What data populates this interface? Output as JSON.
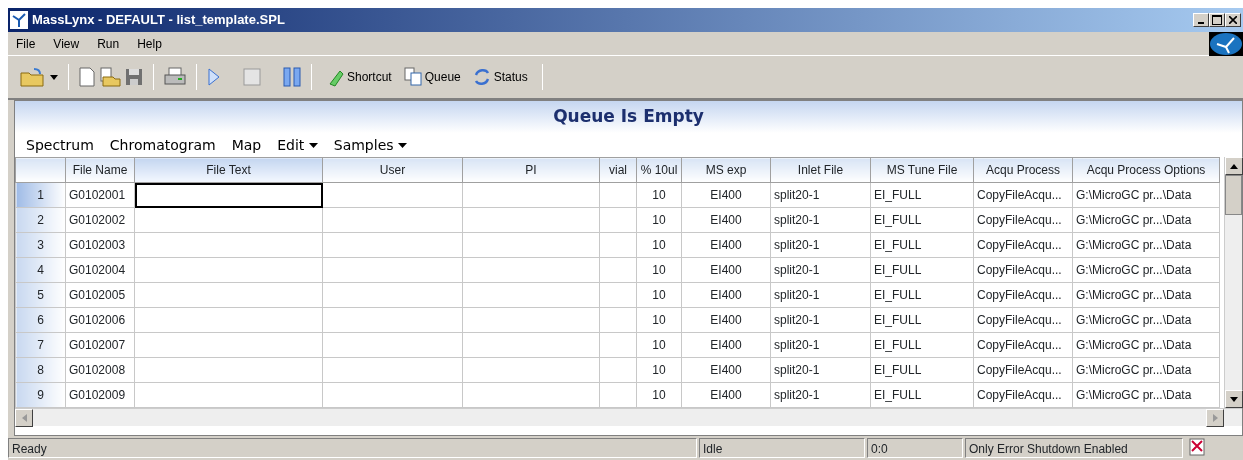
{
  "window": {
    "title": "MassLynx - DEFAULT - list_template.SPL"
  },
  "menu": [
    "File",
    "View",
    "Run",
    "Help"
  ],
  "toolbar_buttons": [
    "Shortcut",
    "Queue",
    "Status"
  ],
  "queue_status": "Queue Is Empty",
  "submenu": [
    {
      "label": "Spectrum",
      "dropdown": false
    },
    {
      "label": "Chromatogram",
      "dropdown": false
    },
    {
      "label": "Map",
      "dropdown": false
    },
    {
      "label": "Edit",
      "dropdown": true
    },
    {
      "label": "Samples",
      "dropdown": true
    }
  ],
  "table": {
    "columns": [
      {
        "label": "File Name",
        "selected": false
      },
      {
        "label": "File Text",
        "selected": true
      },
      {
        "label": "User",
        "selected": false
      },
      {
        "label": "PI",
        "selected": false
      },
      {
        "label": "vial",
        "selected": false
      },
      {
        "label": "% 10ul",
        "selected": false
      },
      {
        "label": "MS exp",
        "selected": false
      },
      {
        "label": "Inlet File",
        "selected": false
      },
      {
        "label": "MS Tune File",
        "selected": false
      },
      {
        "label": "Acqu Process",
        "selected": false
      },
      {
        "label": "Acqu Process Options",
        "selected": false
      }
    ],
    "rows": [
      {
        "number": "1",
        "selected": true,
        "cells": [
          "G0102001",
          "",
          "",
          "",
          "",
          "10",
          "EI400",
          "split20-1",
          "EI_FULL",
          "CopyFileAcqu...",
          "G:\\MicroGC pr...\\Data"
        ]
      },
      {
        "number": "2",
        "selected": false,
        "cells": [
          "G0102002",
          "",
          "",
          "",
          "",
          "10",
          "EI400",
          "split20-1",
          "EI_FULL",
          "CopyFileAcqu...",
          "G:\\MicroGC pr...\\Data"
        ]
      },
      {
        "number": "3",
        "selected": false,
        "cells": [
          "G0102003",
          "",
          "",
          "",
          "",
          "10",
          "EI400",
          "split20-1",
          "EI_FULL",
          "CopyFileAcqu...",
          "G:\\MicroGC pr...\\Data"
        ]
      },
      {
        "number": "4",
        "selected": false,
        "cells": [
          "G0102004",
          "",
          "",
          "",
          "",
          "10",
          "EI400",
          "split20-1",
          "EI_FULL",
          "CopyFileAcqu...",
          "G:\\MicroGC pr...\\Data"
        ]
      },
      {
        "number": "5",
        "selected": false,
        "cells": [
          "G0102005",
          "",
          "",
          "",
          "",
          "10",
          "EI400",
          "split20-1",
          "EI_FULL",
          "CopyFileAcqu...",
          "G:\\MicroGC pr...\\Data"
        ]
      },
      {
        "number": "6",
        "selected": false,
        "cells": [
          "G0102006",
          "",
          "",
          "",
          "",
          "10",
          "EI400",
          "split20-1",
          "EI_FULL",
          "CopyFileAcqu...",
          "G:\\MicroGC pr...\\Data"
        ]
      },
      {
        "number": "7",
        "selected": false,
        "cells": [
          "G0102007",
          "",
          "",
          "",
          "",
          "10",
          "EI400",
          "split20-1",
          "EI_FULL",
          "CopyFileAcqu...",
          "G:\\MicroGC pr...\\Data"
        ]
      },
      {
        "number": "8",
        "selected": false,
        "cells": [
          "G0102008",
          "",
          "",
          "",
          "",
          "10",
          "EI400",
          "split20-1",
          "EI_FULL",
          "CopyFileAcqu...",
          "G:\\MicroGC pr...\\Data"
        ]
      },
      {
        "number": "9",
        "selected": false,
        "cells": [
          "G0102009",
          "",
          "",
          "",
          "",
          "10",
          "EI400",
          "split20-1",
          "EI_FULL",
          "CopyFileAcqu...",
          "G:\\MicroGC pr...\\Data"
        ]
      }
    ]
  },
  "status_bar": [
    "Ready",
    "Idle",
    "0:0",
    "Only Error Shutdown Enabled"
  ]
}
